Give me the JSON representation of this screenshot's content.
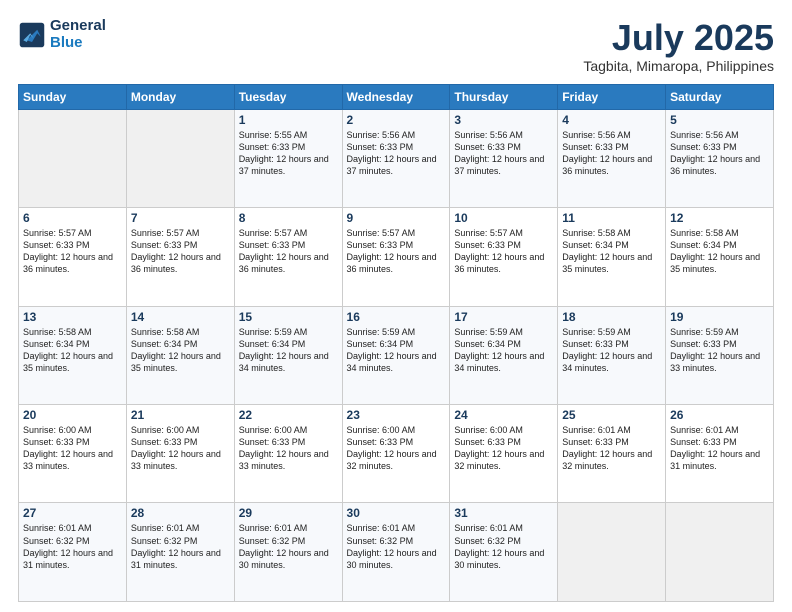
{
  "header": {
    "logo_line1": "General",
    "logo_line2": "Blue",
    "month_year": "July 2025",
    "location": "Tagbita, Mimaropa, Philippines"
  },
  "weekdays": [
    "Sunday",
    "Monday",
    "Tuesday",
    "Wednesday",
    "Thursday",
    "Friday",
    "Saturday"
  ],
  "weeks": [
    [
      {
        "day": "",
        "text": ""
      },
      {
        "day": "",
        "text": ""
      },
      {
        "day": "1",
        "text": "Sunrise: 5:55 AM\nSunset: 6:33 PM\nDaylight: 12 hours and 37 minutes."
      },
      {
        "day": "2",
        "text": "Sunrise: 5:56 AM\nSunset: 6:33 PM\nDaylight: 12 hours and 37 minutes."
      },
      {
        "day": "3",
        "text": "Sunrise: 5:56 AM\nSunset: 6:33 PM\nDaylight: 12 hours and 37 minutes."
      },
      {
        "day": "4",
        "text": "Sunrise: 5:56 AM\nSunset: 6:33 PM\nDaylight: 12 hours and 36 minutes."
      },
      {
        "day": "5",
        "text": "Sunrise: 5:56 AM\nSunset: 6:33 PM\nDaylight: 12 hours and 36 minutes."
      }
    ],
    [
      {
        "day": "6",
        "text": "Sunrise: 5:57 AM\nSunset: 6:33 PM\nDaylight: 12 hours and 36 minutes."
      },
      {
        "day": "7",
        "text": "Sunrise: 5:57 AM\nSunset: 6:33 PM\nDaylight: 12 hours and 36 minutes."
      },
      {
        "day": "8",
        "text": "Sunrise: 5:57 AM\nSunset: 6:33 PM\nDaylight: 12 hours and 36 minutes."
      },
      {
        "day": "9",
        "text": "Sunrise: 5:57 AM\nSunset: 6:33 PM\nDaylight: 12 hours and 36 minutes."
      },
      {
        "day": "10",
        "text": "Sunrise: 5:57 AM\nSunset: 6:33 PM\nDaylight: 12 hours and 36 minutes."
      },
      {
        "day": "11",
        "text": "Sunrise: 5:58 AM\nSunset: 6:34 PM\nDaylight: 12 hours and 35 minutes."
      },
      {
        "day": "12",
        "text": "Sunrise: 5:58 AM\nSunset: 6:34 PM\nDaylight: 12 hours and 35 minutes."
      }
    ],
    [
      {
        "day": "13",
        "text": "Sunrise: 5:58 AM\nSunset: 6:34 PM\nDaylight: 12 hours and 35 minutes."
      },
      {
        "day": "14",
        "text": "Sunrise: 5:58 AM\nSunset: 6:34 PM\nDaylight: 12 hours and 35 minutes."
      },
      {
        "day": "15",
        "text": "Sunrise: 5:59 AM\nSunset: 6:34 PM\nDaylight: 12 hours and 34 minutes."
      },
      {
        "day": "16",
        "text": "Sunrise: 5:59 AM\nSunset: 6:34 PM\nDaylight: 12 hours and 34 minutes."
      },
      {
        "day": "17",
        "text": "Sunrise: 5:59 AM\nSunset: 6:34 PM\nDaylight: 12 hours and 34 minutes."
      },
      {
        "day": "18",
        "text": "Sunrise: 5:59 AM\nSunset: 6:33 PM\nDaylight: 12 hours and 34 minutes."
      },
      {
        "day": "19",
        "text": "Sunrise: 5:59 AM\nSunset: 6:33 PM\nDaylight: 12 hours and 33 minutes."
      }
    ],
    [
      {
        "day": "20",
        "text": "Sunrise: 6:00 AM\nSunset: 6:33 PM\nDaylight: 12 hours and 33 minutes."
      },
      {
        "day": "21",
        "text": "Sunrise: 6:00 AM\nSunset: 6:33 PM\nDaylight: 12 hours and 33 minutes."
      },
      {
        "day": "22",
        "text": "Sunrise: 6:00 AM\nSunset: 6:33 PM\nDaylight: 12 hours and 33 minutes."
      },
      {
        "day": "23",
        "text": "Sunrise: 6:00 AM\nSunset: 6:33 PM\nDaylight: 12 hours and 32 minutes."
      },
      {
        "day": "24",
        "text": "Sunrise: 6:00 AM\nSunset: 6:33 PM\nDaylight: 12 hours and 32 minutes."
      },
      {
        "day": "25",
        "text": "Sunrise: 6:01 AM\nSunset: 6:33 PM\nDaylight: 12 hours and 32 minutes."
      },
      {
        "day": "26",
        "text": "Sunrise: 6:01 AM\nSunset: 6:33 PM\nDaylight: 12 hours and 31 minutes."
      }
    ],
    [
      {
        "day": "27",
        "text": "Sunrise: 6:01 AM\nSunset: 6:32 PM\nDaylight: 12 hours and 31 minutes."
      },
      {
        "day": "28",
        "text": "Sunrise: 6:01 AM\nSunset: 6:32 PM\nDaylight: 12 hours and 31 minutes."
      },
      {
        "day": "29",
        "text": "Sunrise: 6:01 AM\nSunset: 6:32 PM\nDaylight: 12 hours and 30 minutes."
      },
      {
        "day": "30",
        "text": "Sunrise: 6:01 AM\nSunset: 6:32 PM\nDaylight: 12 hours and 30 minutes."
      },
      {
        "day": "31",
        "text": "Sunrise: 6:01 AM\nSunset: 6:32 PM\nDaylight: 12 hours and 30 minutes."
      },
      {
        "day": "",
        "text": ""
      },
      {
        "day": "",
        "text": ""
      }
    ]
  ]
}
